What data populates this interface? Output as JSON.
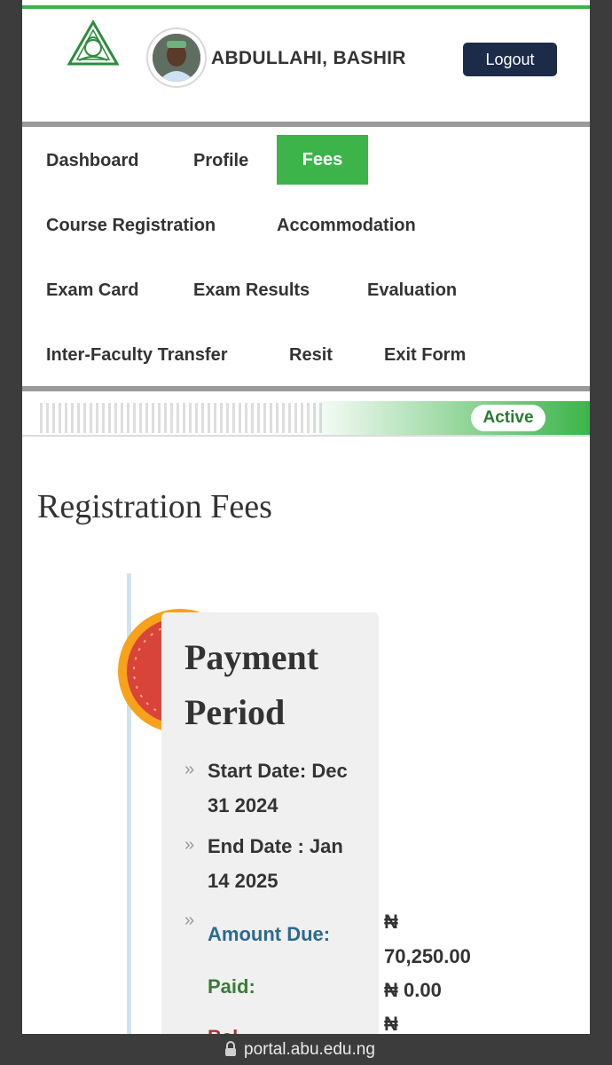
{
  "user": {
    "name": "ABDULLAHI, BASHIR"
  },
  "header": {
    "logout_label": "Logout"
  },
  "nav": {
    "dashboard": "Dashboard",
    "profile": "Profile",
    "fees": "Fees",
    "course_registration": "Course Registration",
    "accommodation": "Accommodation",
    "exam_card": "Exam Card",
    "exam_results": "Exam Results",
    "evaluation": "Evaluation",
    "inter_faculty_transfer": "Inter-Faculty Transfer",
    "resit": "Resit",
    "exit_form": "Exit Form"
  },
  "status": {
    "badge": "Active"
  },
  "main": {
    "title": "Registration Fees"
  },
  "payment": {
    "heading_line1": "Payment",
    "heading_line2": "Period",
    "start_line1": "Start Date: Dec",
    "start_line2": "31 2024",
    "end_line1": "End Date : Jan",
    "end_line2": "14 2025",
    "amount_due_label": "Amount Due:",
    "amount_due_currency": "₦",
    "amount_due_value": "70,250.00",
    "paid_label": "Paid:",
    "paid_value": "₦ 0.00",
    "balance_label": "Bal...",
    "balance_currency": "₦"
  },
  "browser": {
    "url": "portal.abu.edu.ng"
  },
  "colors": {
    "green": "#3cb44a",
    "navy": "#1c2b48",
    "due": "#2c6b8e",
    "paid": "#3d7a38"
  }
}
